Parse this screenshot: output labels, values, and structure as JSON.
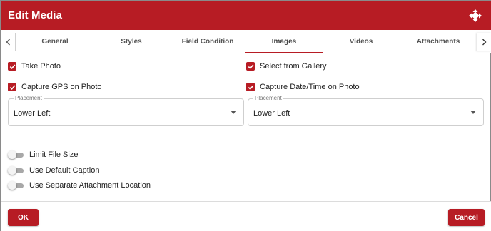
{
  "header": {
    "title": "Edit Media",
    "move_icon": "move-arrows-icon"
  },
  "colors": {
    "brand": "#b71c24",
    "toggle_off": "#a8a8a8"
  },
  "tabs": {
    "items": [
      "General",
      "Styles",
      "Field Condition",
      "Images",
      "Videos",
      "Attachments"
    ],
    "active": "Images",
    "left_arrow_icon": "chevron-left-icon",
    "right_arrow_icon": "chevron-right-icon"
  },
  "images": {
    "take_photo": {
      "label": "Take Photo",
      "checked": true
    },
    "select_from_gallery": {
      "label": "Select from Gallery",
      "checked": true
    },
    "capture_gps": {
      "label": "Capture GPS on Photo",
      "checked": true
    },
    "capture_datetime": {
      "label": "Capture Date/Time on Photo",
      "checked": true
    },
    "gps_placement": {
      "label": "Placement",
      "value": "Lower Left"
    },
    "datetime_placement": {
      "label": "Placement",
      "value": "Lower Left"
    },
    "limit_file_size": {
      "label": "Limit File Size",
      "on": false
    },
    "use_default_caption": {
      "label": "Use Default Caption",
      "on": false
    },
    "use_separate_location": {
      "label": "Use Separate Attachment Location",
      "on": false
    }
  },
  "footer": {
    "ok_label": "OK",
    "cancel_label": "Cancel"
  }
}
